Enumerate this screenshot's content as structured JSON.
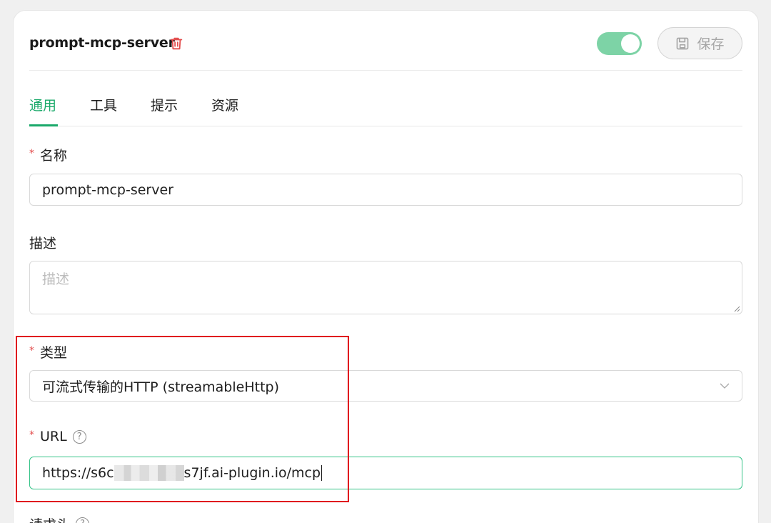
{
  "header": {
    "title": "prompt-mcp-server",
    "save_label": "保存",
    "enabled": true
  },
  "tabs": [
    {
      "label": "通用",
      "active": true
    },
    {
      "label": "工具",
      "active": false
    },
    {
      "label": "提示",
      "active": false
    },
    {
      "label": "资源",
      "active": false
    }
  ],
  "form": {
    "name": {
      "label": "名称",
      "required": "*",
      "value": "prompt-mcp-server"
    },
    "description": {
      "label": "描述",
      "placeholder": "描述",
      "value": ""
    },
    "type": {
      "label": "类型",
      "required": "*",
      "value": "可流式传输的HTTP (streamableHttp)"
    },
    "url": {
      "label": "URL",
      "required": "*",
      "value_prefix": "https://s6c",
      "value_suffix": "s7jf.ai-plugin.io/mcp",
      "help": "?"
    },
    "headers": {
      "label": "请求头",
      "help": "?"
    }
  },
  "colors": {
    "accent": "#1aa96a",
    "toggle_on": "#7dd3a6",
    "required": "#e34d4d",
    "highlight_box": "#e0141e"
  },
  "icons": {
    "delete": "trash-icon",
    "save": "floppy-disk-icon",
    "select": "chevron-down-icon",
    "help": "question-circle-icon"
  }
}
